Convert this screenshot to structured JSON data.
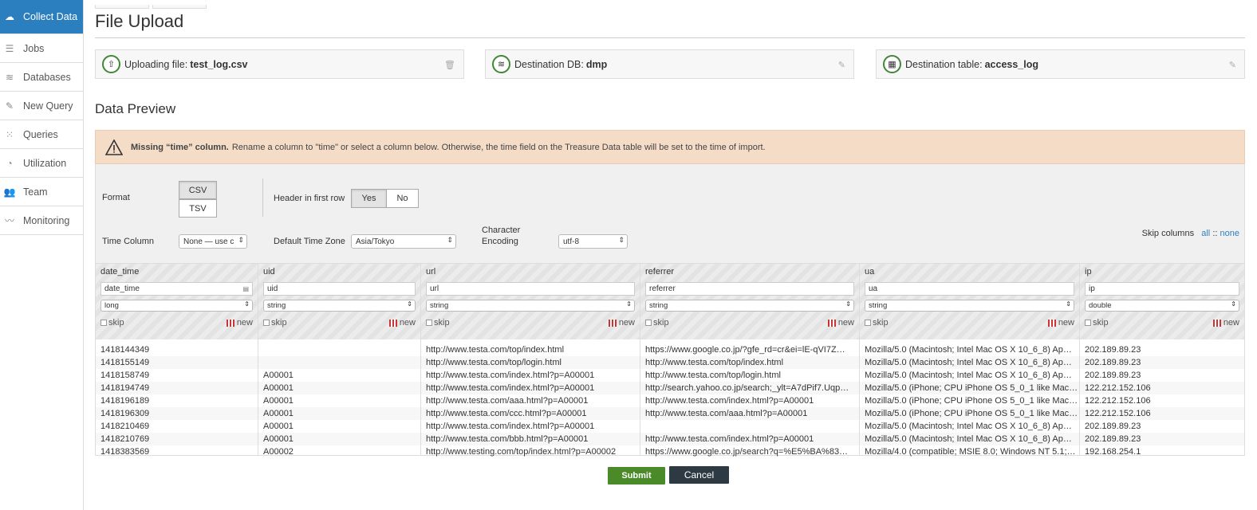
{
  "sidebar": {
    "items": [
      {
        "label": "Collect Data",
        "icon": "cloud-upload-icon",
        "glyph": "☁",
        "active": true
      },
      {
        "label": "Jobs",
        "icon": "list-icon",
        "glyph": "☰"
      },
      {
        "label": "Databases",
        "icon": "database-icon",
        "glyph": "≋"
      },
      {
        "label": "New Query",
        "icon": "edit-icon",
        "glyph": "✎"
      },
      {
        "label": "Queries",
        "icon": "grid-icon",
        "glyph": "⁙"
      },
      {
        "label": "Utilization",
        "icon": "gauge-icon",
        "glyph": "◔"
      },
      {
        "label": "Team",
        "icon": "users-icon",
        "glyph": "👥"
      },
      {
        "label": "Monitoring",
        "icon": "chart-icon",
        "glyph": "〰"
      }
    ]
  },
  "page": {
    "title": "File Upload"
  },
  "info": {
    "upload_label": "Uploading file:",
    "upload_value": "test_log.csv",
    "db_label": "Destination DB:",
    "db_value": "dmp",
    "table_label": "Destination table:",
    "table_value": "access_log"
  },
  "preview": {
    "title": "Data Preview"
  },
  "warning": {
    "bold": "Missing “time” column.",
    "text": "Rename a column to \"time\" or select a column below. Otherwise, the time field on the Treasure Data table will be set to the time of import."
  },
  "options": {
    "format_label": "Format",
    "format_csv": "CSV",
    "format_tsv": "TSV",
    "header_label": "Header in first row",
    "header_yes": "Yes",
    "header_no": "No",
    "time_column_label": "Time Column",
    "time_column_value": "None — use c",
    "timezone_label": "Default Time Zone",
    "timezone_value": "Asia/Tokyo",
    "encoding_label_1": "Character",
    "encoding_label_2": "Encoding",
    "encoding_value": "utf-8",
    "skip_columns_label": "Skip columns",
    "skip_all": "all",
    "skip_sep": "::",
    "skip_none": "none"
  },
  "table": {
    "skip_label": "skip",
    "new_label": "new",
    "columns": [
      {
        "name": "date_time",
        "input": "date_time",
        "type": "long",
        "values": [
          "1418144349",
          "1418155149",
          "1418158749",
          "1418194749",
          "1418196189",
          "1418196309",
          "1418210469",
          "1418210769",
          "1418383569"
        ]
      },
      {
        "name": "uid",
        "input": "uid",
        "type": "string",
        "values": [
          "",
          "",
          "A00001",
          "A00001",
          "A00001",
          "A00001",
          "A00001",
          "A00001",
          "A00002"
        ]
      },
      {
        "name": "url",
        "input": "url",
        "type": "string",
        "values": [
          "http://www.testa.com/top/index.html",
          "http://www.testa.com/top/login.html",
          "http://www.testa.com/index.html?p=A00001",
          "http://www.testa.com/index.html?p=A00001",
          "http://www.testa.com/aaa.html?p=A00001",
          "http://www.testa.com/ccc.html?p=A00001",
          "http://www.testa.com/index.html?p=A00001",
          "http://www.testa.com/bbb.html?p=A00001",
          "http://www.testing.com/top/index.html?p=A00002"
        ]
      },
      {
        "name": "referrer",
        "input": "referrer",
        "type": "string",
        "values": [
          "https://www.google.co.jp/?gfe_rd=cr&ei=lE-qVI7Z…",
          "http://www.testa.com/top/index.html",
          "http://www.testa.com/top/login.html",
          "http://search.yahoo.co.jp/search;_ylt=A7dPif7.Uqp…",
          "http://www.testa.com/index.html?p=A00001",
          "http://www.testa.com/aaa.html?p=A00001",
          "",
          "http://www.testa.com/index.html?p=A00001",
          "https://www.google.co.jp/search?q=%E5%BA%83…"
        ]
      },
      {
        "name": "ua",
        "input": "ua",
        "type": "string",
        "values": [
          "Mozilla/5.0 (Macintosh; Intel Mac OS X 10_6_8) Ap…",
          "Mozilla/5.0 (Macintosh; Intel Mac OS X 10_6_8) Ap…",
          "Mozilla/5.0 (Macintosh; Intel Mac OS X 10_6_8) Ap…",
          "Mozilla/5.0 (iPhone; CPU iPhone OS 5_0_1 like Mac…",
          "Mozilla/5.0 (iPhone; CPU iPhone OS 5_0_1 like Mac…",
          "Mozilla/5.0 (iPhone; CPU iPhone OS 5_0_1 like Mac…",
          "Mozilla/5.0 (Macintosh; Intel Mac OS X 10_6_8) Ap…",
          "Mozilla/5.0 (Macintosh; Intel Mac OS X 10_6_8) Ap…",
          "Mozilla/4.0 (compatible; MSIE 8.0; Windows NT 5.1;…"
        ]
      },
      {
        "name": "ip",
        "input": "ip",
        "type": "double",
        "values": [
          "202.189.89.23",
          "202.189.89.23",
          "202.189.89.23",
          "122.212.152.106",
          "122.212.152.106",
          "122.212.152.106",
          "202.189.89.23",
          "202.189.89.23",
          "192.168.254.1"
        ]
      }
    ]
  },
  "buttons": {
    "submit": "Submit",
    "cancel": "Cancel"
  },
  "colors": {
    "accent": "#2c7fbf",
    "submit": "#4a8a28",
    "cancel": "#2d3a44",
    "warning_bg": "#f5dcc7"
  }
}
